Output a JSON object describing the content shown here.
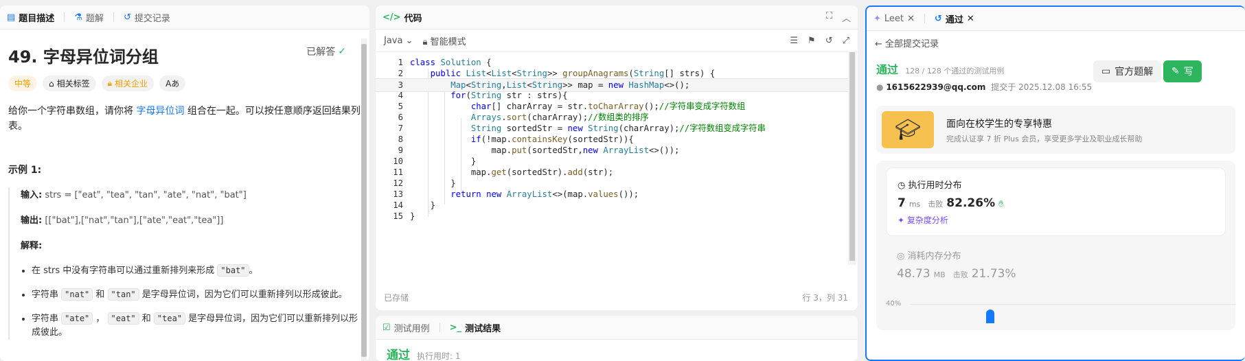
{
  "left": {
    "tabs": [
      {
        "label": "题目描述",
        "icon": "description-icon"
      },
      {
        "label": "题解",
        "icon": "flask-icon"
      },
      {
        "label": "提交记录",
        "icon": "history-icon"
      }
    ],
    "title": "49. 字母异位词分组",
    "solved_label": "已解答",
    "tags": {
      "difficulty": "中等",
      "topics": "相关标签",
      "companies": "相关企业",
      "translate": "Aあ"
    },
    "desc_part1": "给你一个字符串数组，请你将 ",
    "desc_link": "字母异位词",
    "desc_part2": " 组合在一起。可以按任意顺序返回结果列表。",
    "example_title": "示例 1:",
    "input_label": "输入:",
    "input_value": " strs = [\"eat\", \"tea\", \"tan\", \"ate\", \"nat\", \"bat\"]",
    "output_label": "输出:",
    "output_value": " [[\"bat\"],[\"nat\",\"tan\"],[\"ate\",\"eat\",\"tea\"]]",
    "explain_label": "解释:",
    "b1_a": "在 strs 中没有字符串可以通过重新排列来形成 ",
    "b1_code": "\"bat\"",
    "b1_b": "。",
    "b2_a": "字符串 ",
    "b2_c1": "\"nat\"",
    "b2_m": " 和 ",
    "b2_c2": "\"tan\"",
    "b2_b": " 是字母异位词，因为它们可以重新排列以形成彼此。",
    "b3_a": "字符串 ",
    "b3_c1": "\"ate\"",
    "b3_m1": " ， ",
    "b3_c2": "\"eat\"",
    "b3_m2": " 和 ",
    "b3_c3": "\"tea\"",
    "b3_b": " 是字母异位词，因为它们可以重新排列以形成彼此。"
  },
  "code": {
    "tab_label": "代码",
    "language": "Java",
    "mode": "智能模式",
    "saved": "已存储",
    "cursor": "行 3，列 31",
    "line_numbers": [
      "1",
      "2",
      "3",
      "4",
      "5",
      "6",
      "7",
      "8",
      "9",
      "10",
      "11",
      "12",
      "13",
      "14",
      "15"
    ]
  },
  "test": {
    "tab_cases": "测试用例",
    "tab_results": "测试结果",
    "result_status": "通过",
    "result_time": "执行用时: 1"
  },
  "right": {
    "tabs": [
      {
        "label": "Leet"
      },
      {
        "label": "通过"
      }
    ],
    "back_label": "全部提交记录",
    "status": "通过",
    "cases": "128 / 128 个通过的测试用例",
    "user": "1615622939@qq.com",
    "submitted": "提交于 2025.12.08 16:55",
    "official_btn": "官方题解",
    "write_btn": "写",
    "promo_title": "面向在校学生的专享特惠",
    "promo_sub": "完成认证享 7 折 Plus 会员，享受更多学业及职业成长帮助",
    "runtime_title": "执行用时分布",
    "runtime_value": "7",
    "runtime_unit": "ms",
    "beat_label": "击败",
    "runtime_beat": "82.26%",
    "complexity": "复杂度分析",
    "memory_title": "消耗内存分布",
    "memory_value": "48.73",
    "memory_unit": "MB",
    "memory_beat": "21.73%",
    "chart_tick": "40%"
  },
  "colors": {
    "accent": "#1677ff",
    "success": "#2db55d",
    "medium": "#f0a000",
    "keyword": "#0000ff",
    "type": "#267f99",
    "comment": "#008000"
  }
}
